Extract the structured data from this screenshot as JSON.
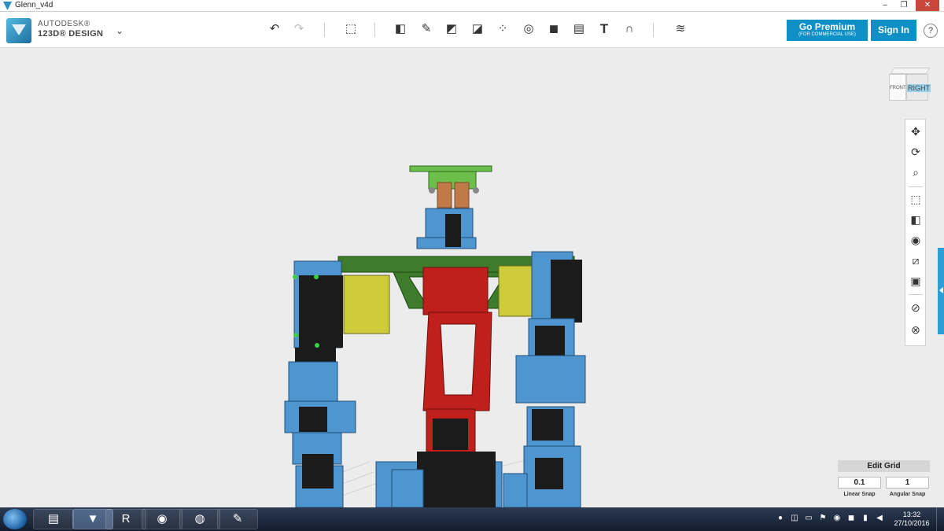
{
  "window": {
    "title": "Glenn_v4d",
    "minimize": "–",
    "maximize": "❐",
    "close": "✕"
  },
  "brand": {
    "line1": "AUTODESK®",
    "line2": "123D® DESIGN",
    "menu_icon": "chevron-down-icon"
  },
  "toolbar": {
    "tools": [
      {
        "name": "undo-icon"
      },
      {
        "name": "redo-icon"
      },
      {
        "name": "transform-icon"
      },
      {
        "name": "primitives-icon"
      },
      {
        "name": "sketch-icon"
      },
      {
        "name": "construct-icon"
      },
      {
        "name": "modify-icon"
      },
      {
        "name": "pattern-icon"
      },
      {
        "name": "group-icon"
      },
      {
        "name": "combine-icon"
      },
      {
        "name": "measure-icon"
      },
      {
        "name": "text-icon"
      },
      {
        "name": "snap-icon"
      },
      {
        "name": "materials-icon"
      }
    ]
  },
  "account": {
    "premium_label": "Go Premium",
    "premium_sub": "(FOR COMMERCIAL USE)",
    "signin_label": "Sign In",
    "help_label": "?"
  },
  "viewcube": {
    "front": "FRONT",
    "right": "RIGHT"
  },
  "navbar": {
    "buttons": [
      "pan-icon",
      "orbit-icon",
      "zoom-icon",
      "fit-icon",
      "views-icon",
      "visibility-icon",
      "hide-sketch-icon",
      "camera-icon",
      "hide-mesh-icon",
      "hide-solid-icon"
    ]
  },
  "edit_grid": {
    "title": "Edit Grid",
    "linear_value": "0.1",
    "angular_value": "1",
    "linear_label": "Linear Snap",
    "angular_label": "Angular Snap"
  },
  "model": {
    "colors": {
      "blue": "#4f95d0",
      "green": "#3e7b2a",
      "red": "#c0201b",
      "yellow": "#cfcc3c",
      "black": "#1b1b1b",
      "copper": "#c07a48",
      "plate": "#6cbf4a"
    }
  },
  "taskbar": {
    "apps": [
      "explorer-icon",
      "123d-design-icon",
      "rrrr-icon",
      "eye-app-icon",
      "chrome-icon",
      "paint-icon"
    ],
    "clock_time": "13:32",
    "clock_date": "27/10/2016"
  }
}
